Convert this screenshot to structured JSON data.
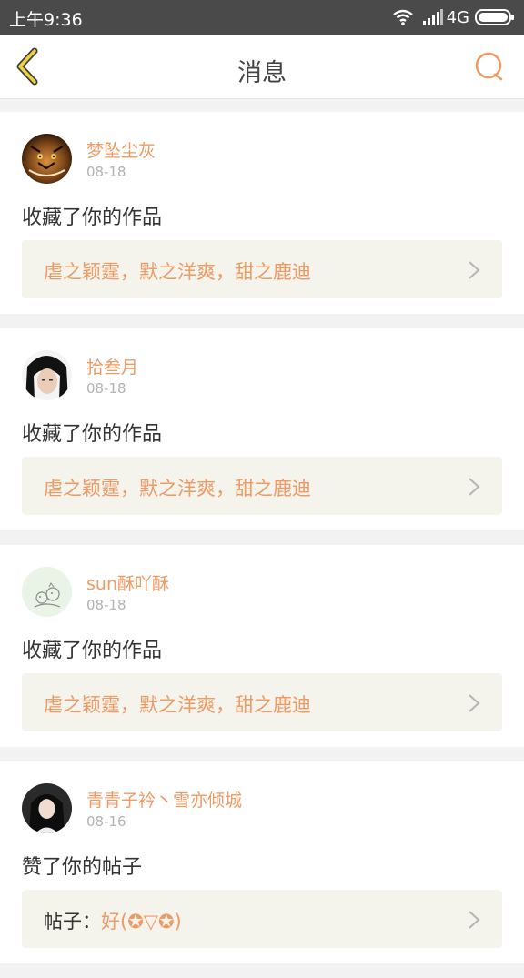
{
  "status_bar": {
    "time": "上午9:36",
    "network": "4G"
  },
  "header": {
    "title": "消息",
    "back_icon": "chevron-left-icon",
    "search_icon": "search-icon",
    "accent": "#f09a63"
  },
  "messages": [
    {
      "user": "梦坠尘灰",
      "date": "08-18",
      "action": "收藏了你的作品",
      "work_title": "虐之颖霆，默之洋爽，甜之鹿迪"
    },
    {
      "user": "拾叁月",
      "date": "08-18",
      "action": "收藏了你的作品",
      "work_title": "虐之颖霆，默之洋爽，甜之鹿迪"
    },
    {
      "user": "sun酥吖酥",
      "date": "08-18",
      "action": "收藏了你的作品",
      "work_title": "虐之颖霆，默之洋爽，甜之鹿迪"
    },
    {
      "user": "青青子衿丶雪亦倾城",
      "date": "08-16",
      "action": "赞了你的帖子",
      "work_prefix": "帖子：",
      "work_title": "好(✪▽✪)"
    }
  ]
}
